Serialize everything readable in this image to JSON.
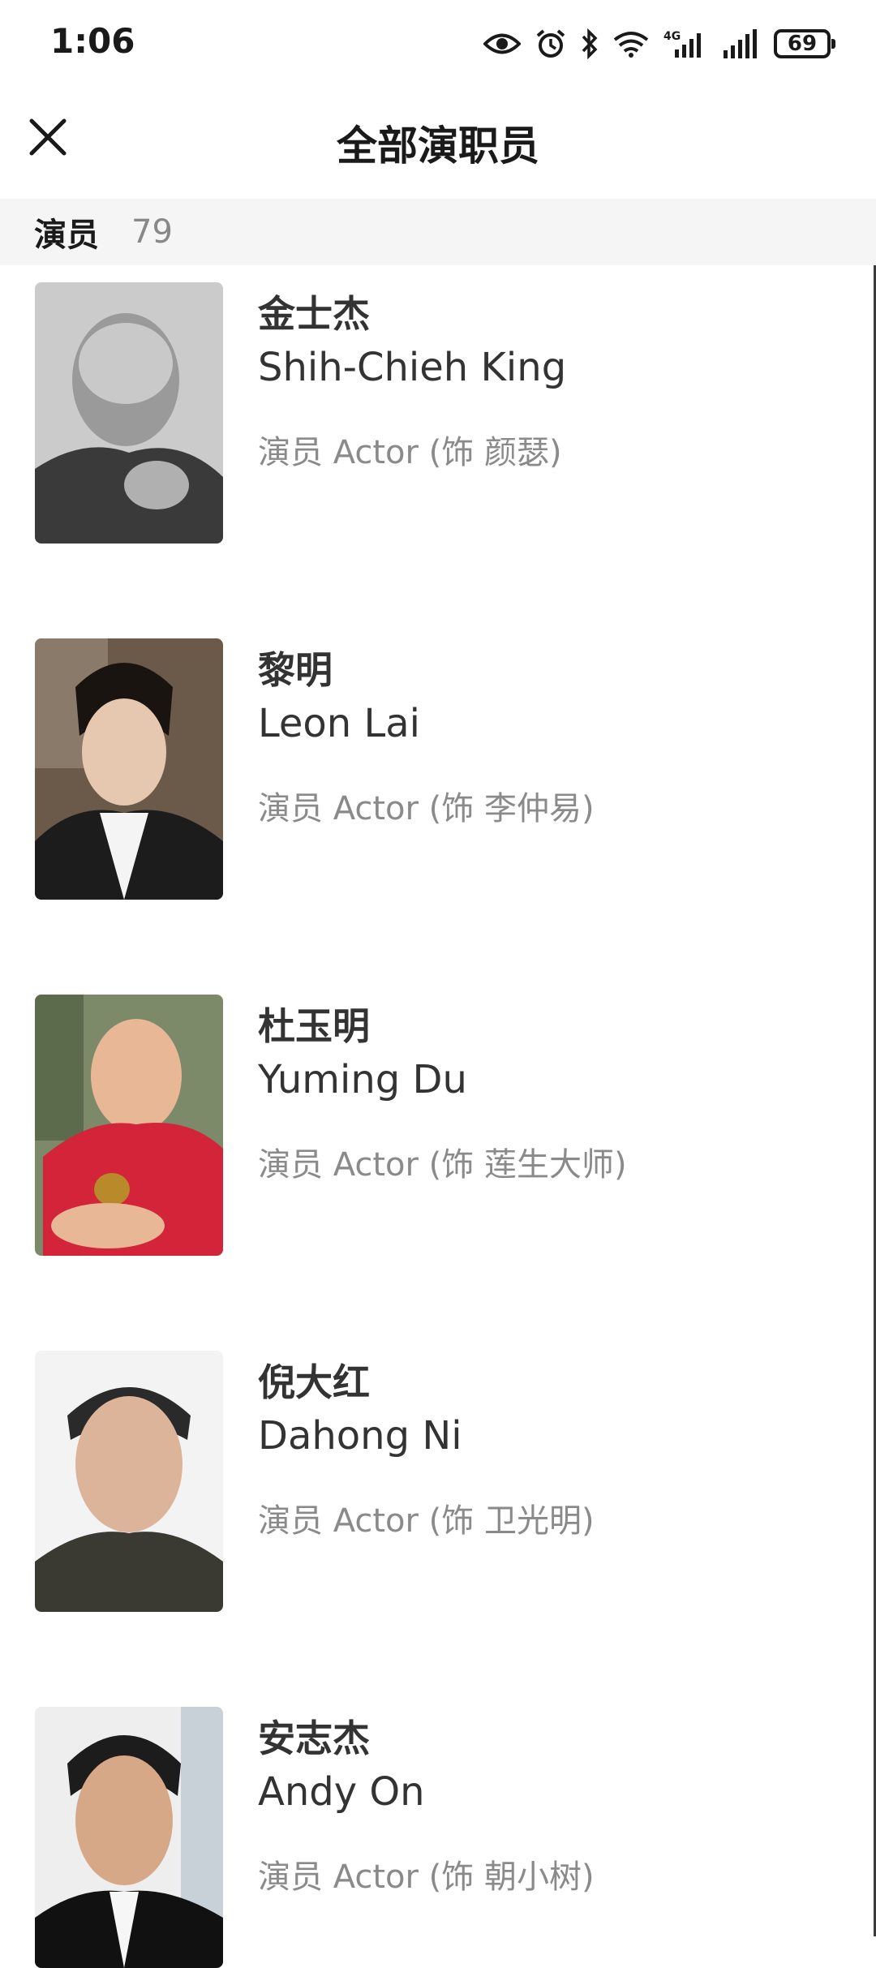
{
  "status_bar": {
    "time": "1:06",
    "battery": "69",
    "icons": [
      "eye-icon",
      "alarm-icon",
      "bluetooth-icon",
      "wifi-icon",
      "4g-signal-icon",
      "signal-icon",
      "battery-icon"
    ]
  },
  "header": {
    "title": "全部演职员",
    "close_icon": "close-icon"
  },
  "section": {
    "label": "演员",
    "count": "79"
  },
  "cast": [
    {
      "name_cn": "金士杰",
      "name_en": "Shih-Chieh King",
      "role": "演员 Actor (饰 颜瑟)"
    },
    {
      "name_cn": "黎明",
      "name_en": "Leon Lai",
      "role": "演员 Actor (饰 李仲易)"
    },
    {
      "name_cn": "杜玉明",
      "name_en": "Yuming Du",
      "role": "演员 Actor (饰 莲生大师)"
    },
    {
      "name_cn": "倪大红",
      "name_en": "Dahong Ni",
      "role": "演员 Actor (饰 卫光明)"
    },
    {
      "name_cn": "安志杰",
      "name_en": "Andy On",
      "role": "演员 Actor (饰 朝小树)"
    }
  ],
  "colors": {
    "section_bg": "#f5f5f5",
    "role_text": "#8a8a8a",
    "count_text": "#888888"
  }
}
